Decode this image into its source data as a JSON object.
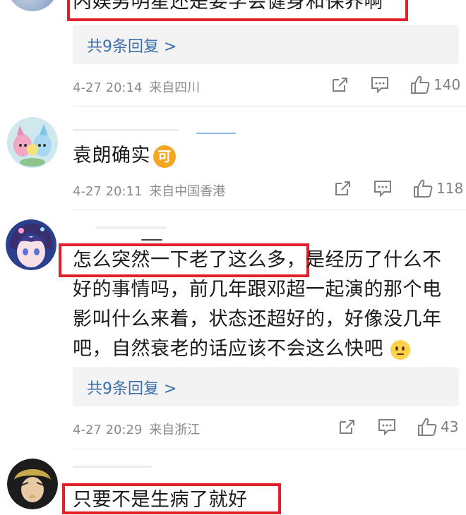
{
  "comments": [
    {
      "text": "内娱男明星还是要学会健身和保养啊",
      "replies_label": "共9条回复 >",
      "date": "4-27 20:14",
      "location": "来自四川",
      "likes": "140"
    },
    {
      "text": "袁朗确实",
      "badge": "可",
      "date": "4-27 20:11",
      "location": "来自中国香港",
      "likes": "118"
    },
    {
      "text_highlight": "怎么突然一下老了这么多",
      "text_rest_1": "，是经历了什么不",
      "text_line_2": "好的事情吗，前几年跟邓超一起演的那个电",
      "text_line_3": "影叫什么来着，状态还超好的，好像没几年",
      "text_line_4": "吧，自然衰老的话应该不会这么快吧",
      "replies_label": "共9条回复 >",
      "date": "4-27 20:29",
      "location": "来自浙江",
      "likes": "43"
    },
    {
      "text": "只要不是生病了就好"
    }
  ],
  "icons": {
    "share": "share-icon",
    "comment": "comment-icon",
    "like": "thumbs-up-icon",
    "emoji": "thinking-face-emoji"
  },
  "colors": {
    "highlight_box": "#e0212b",
    "reply_link": "#3d6fa8",
    "meta_text": "#8a8a8a",
    "badge": "#f5a623"
  }
}
